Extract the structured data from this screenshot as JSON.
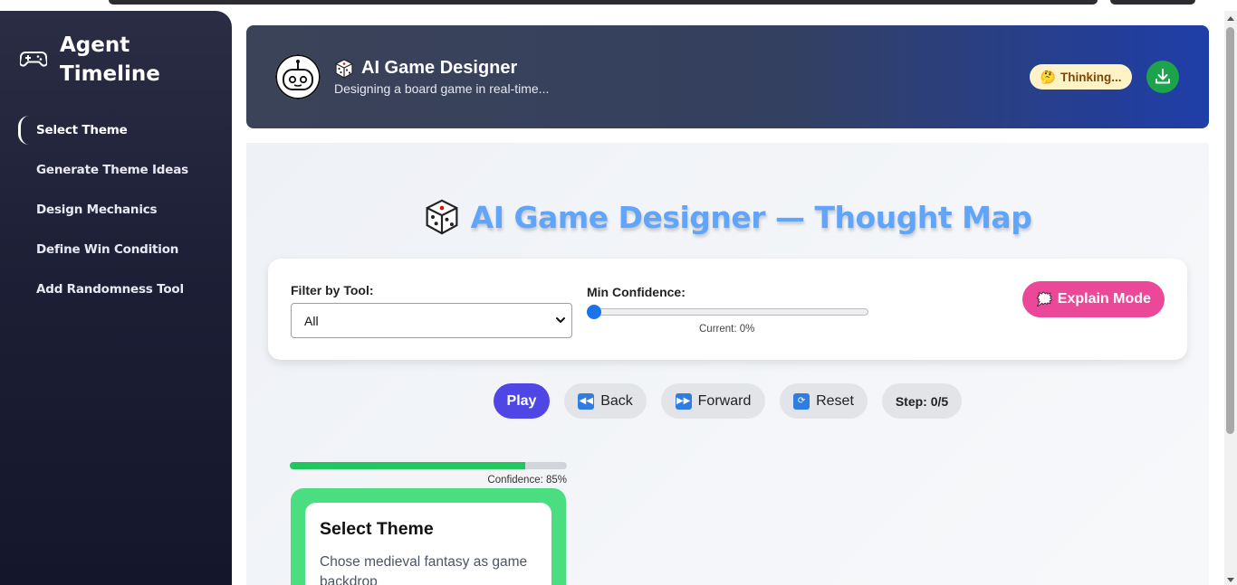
{
  "sidebar": {
    "title": "Agent Timeline",
    "icon": "gamepad-icon",
    "steps": [
      {
        "label": "Select Theme",
        "active": true
      },
      {
        "label": "Generate Theme Ideas",
        "active": false
      },
      {
        "label": "Design Mechanics",
        "active": false
      },
      {
        "label": "Define Win Condition",
        "active": false
      },
      {
        "label": "Add Randomness Tool",
        "active": false
      }
    ]
  },
  "header": {
    "title": "AI Game Designer",
    "subtitle": "Designing a board game in real-time...",
    "status": "Thinking...",
    "status_emoji": "🤔",
    "download_icon": "download-icon",
    "colors": {
      "start": "#3b4358",
      "end": "#1f3ea8",
      "status_bg": "#fef3c7",
      "download_bg": "#1ea34d"
    }
  },
  "map": {
    "title": "AI Game Designer — Thought Map",
    "title_color": "#60a5fa"
  },
  "controls": {
    "filter_label": "Filter by Tool:",
    "filter_value": "All",
    "confidence_label": "Min Confidence:",
    "confidence_current": "Current: 0%",
    "confidence_value": 0,
    "explain_button": "Explain Mode",
    "explain_icon": "🗯️",
    "explain_color": "#ec4899"
  },
  "playback": {
    "play": "Play",
    "back": "Back",
    "forward": "Forward",
    "reset": "Reset",
    "step": "Step: 0/5",
    "play_color": "#4f46e5"
  },
  "cards": [
    {
      "title": "Select Theme",
      "description": "Chose medieval fantasy as game backdrop",
      "confidence_label": "Confidence: 85%",
      "confidence": 0.85,
      "color": "#4ade80"
    }
  ]
}
